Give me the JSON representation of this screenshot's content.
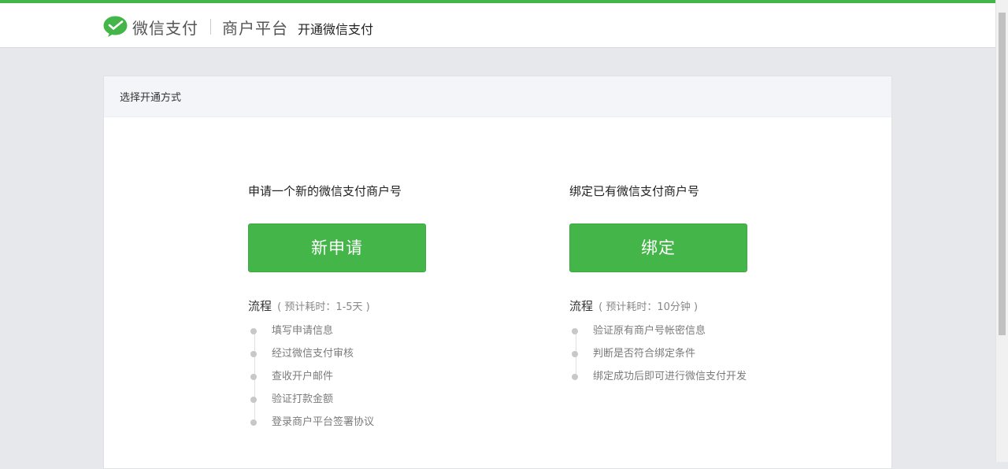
{
  "header": {
    "brand_name": "微信支付",
    "platform": "商户平台",
    "page_subtitle": "开通微信支付",
    "accent_color": "#44b549"
  },
  "panel": {
    "title": "选择开通方式"
  },
  "options": [
    {
      "description": "申请一个新的微信支付商户号",
      "button_label": "新申请",
      "flow_label": "流程",
      "flow_estimate": "( 预计耗时：1-5天 )",
      "steps": [
        "填写申请信息",
        "经过微信支付审核",
        "查收开户邮件",
        "验证打款金额",
        "登录商户平台签署协议"
      ]
    },
    {
      "description": "绑定已有微信支付商户号",
      "button_label": "绑定",
      "flow_label": "流程",
      "flow_estimate": "( 预计耗时：10分钟 )",
      "steps": [
        "验证原有商户号帐密信息",
        "判断是否符合绑定条件",
        "绑定成功后即可进行微信支付开发"
      ]
    }
  ],
  "icons": {
    "logo": "wechat-pay-logo-icon",
    "step_marker": "dot-icon"
  }
}
